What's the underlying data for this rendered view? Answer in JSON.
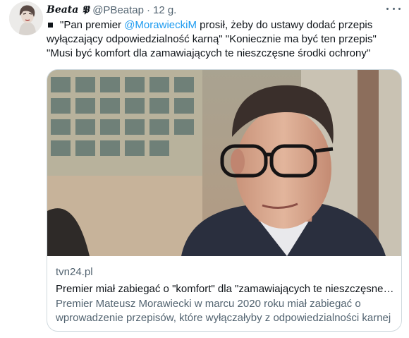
{
  "tweet": {
    "author": {
      "display_name": "Beata 𝕻",
      "handle": "@PBeatap",
      "avatar_icon": "avatar-portrait"
    },
    "separator": "·",
    "timestamp": "12 g.",
    "more_icon": "more-horizontal-icon",
    "text": {
      "bullet_icon": "black-square-icon",
      "part1": "\"Pan premier ",
      "mention": "@MorawieckiM",
      "part2": "  prosił, żeby do ustawy dodać przepis wyłączający odpowiedzialność karną\" \"Koniecznie ma być ten przepis\" \"Musi być komfort dla zamawiających te nieszczęsne środki ochrony\""
    },
    "card": {
      "image": "news-photo-man-with-glasses",
      "domain": "tvn24.pl",
      "title": "Premier miał zabiegać o \"komfort\" dla \"zamawiających te nieszczęsne środki ochrony\"",
      "description_line1": "Premier Mateusz Morawiecki w marcu 2020 roku miał zabiegać o",
      "description_line2": "wprowadzenie przepisów, które wyłączałyby z odpowiedzialności karnej"
    }
  },
  "colors": {
    "link": "#1d9bf0",
    "secondary_text": "#536471",
    "primary_text": "#0f1419",
    "border": "#cfd9de"
  }
}
